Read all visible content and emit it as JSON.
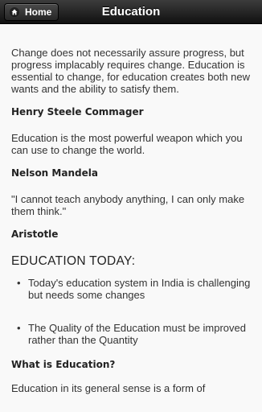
{
  "header": {
    "home_label": "Home",
    "title": "Education"
  },
  "quotes": [
    {
      "text": "Change does not necessarily assure progress, but progress implacably requires change. Education is essential to change, for education creates both new wants and the ability to satisfy them.",
      "author": "Henry Steele Commager"
    },
    {
      "text": "Education is the most powerful weapon which you can use to change the world.",
      "author": "Nelson Mandela"
    },
    {
      "text": "\"I cannot teach anybody anything, I can only make them think.\"",
      "author": "Aristotle"
    }
  ],
  "section": {
    "title": "EDUCATION TODAY:",
    "bullets": [
      "Today's education system in India is challenging but needs some changes",
      "The Quality of the Education must be improved rather than the Quantity"
    ]
  },
  "what_is": {
    "heading": "What is Education?",
    "text": "Education in its general sense is a form of"
  }
}
